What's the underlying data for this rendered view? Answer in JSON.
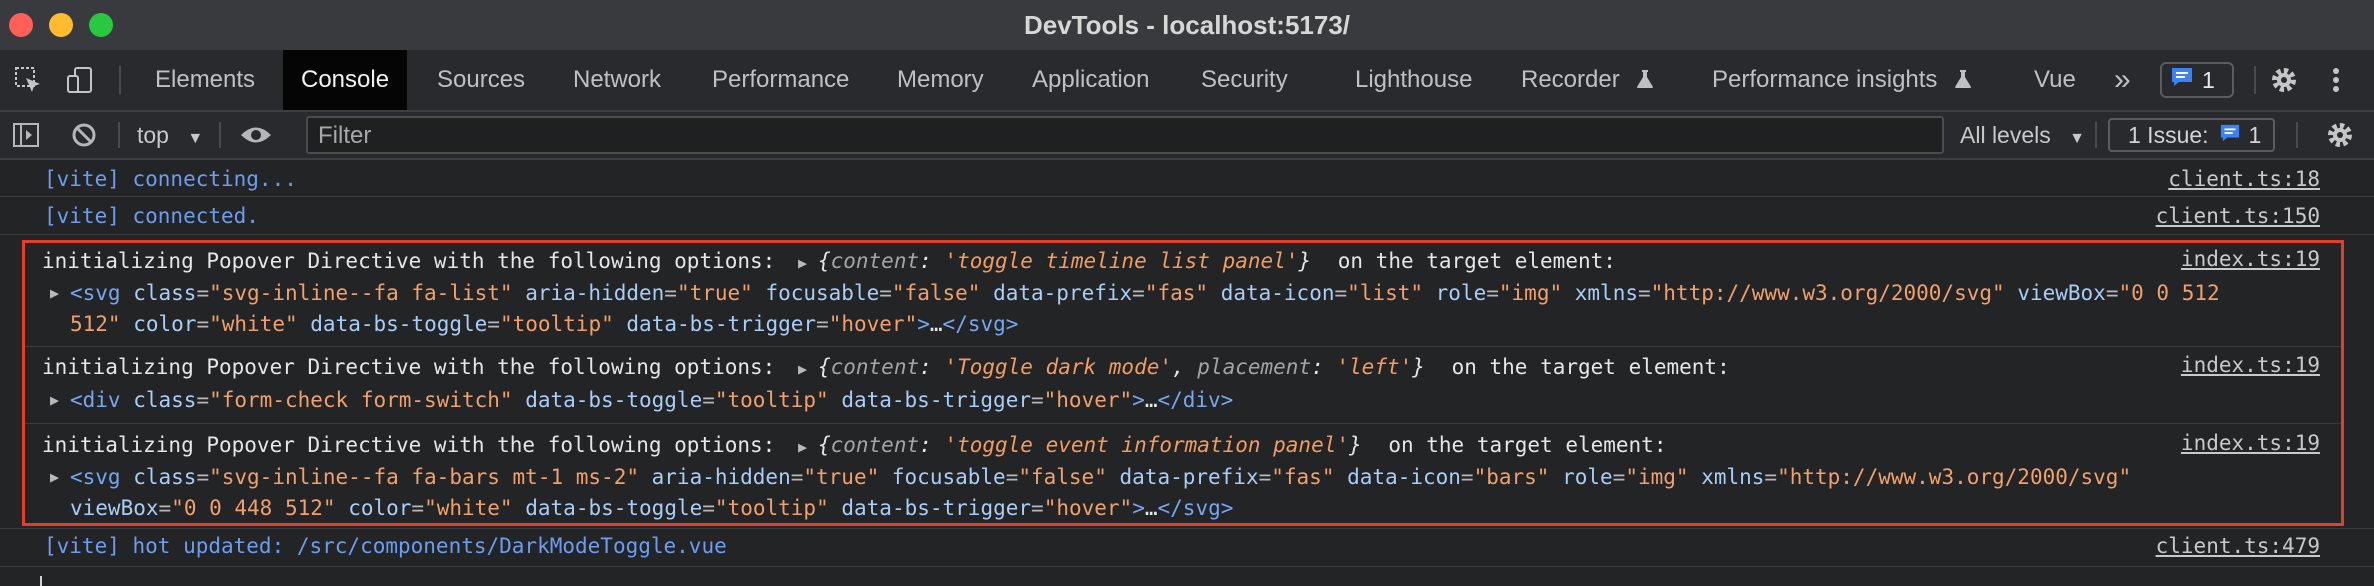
{
  "window": {
    "title": "DevTools - localhost:5173/"
  },
  "tabs": {
    "elements": "Elements",
    "console": "Console",
    "sources": "Sources",
    "network": "Network",
    "performance": "Performance",
    "memory": "Memory",
    "application": "Application",
    "security": "Security",
    "lighthouse": "Lighthouse",
    "recorder": "Recorder",
    "performance_insights": "Performance insights",
    "vue": "Vue",
    "more": "»",
    "message_count": "1"
  },
  "toolbar": {
    "context": "top",
    "filter_placeholder": "Filter",
    "levels": "All levels",
    "issues_label": "1 Issue:",
    "issues_count": "1"
  },
  "console": {
    "rows": [
      {
        "text": "[vite] connecting...",
        "source": "client.ts:18"
      },
      {
        "text": "[vite] connected.",
        "source": "client.ts:150"
      }
    ],
    "popover_logs": [
      {
        "prefix": "initializing Popover Directive with the following options: ",
        "options": [
          {
            "key": "content",
            "value": "'toggle timeline list panel'"
          }
        ],
        "suffix": "on the target element:",
        "source": "index.ts:19",
        "element_lines": [
          "<svg class=\"svg-inline--fa fa-list\" aria-hidden=\"true\" focusable=\"false\" data-prefix=\"fas\" data-icon=\"list\" role=\"img\" xmlns=\"http://www.w3.org/2000/svg\" viewBox=\"0 0 512",
          "512\" color=\"white\" data-bs-toggle=\"tooltip\" data-bs-trigger=\"hover\">…</svg>"
        ]
      },
      {
        "prefix": "initializing Popover Directive with the following options: ",
        "options": [
          {
            "key": "content",
            "value": "'Toggle dark mode'"
          },
          {
            "key": "placement",
            "value": "'left'"
          }
        ],
        "suffix": "on the target element:",
        "source": "index.ts:19",
        "element_lines": [
          "<div class=\"form-check form-switch\" data-bs-toggle=\"tooltip\" data-bs-trigger=\"hover\">…</div>"
        ]
      },
      {
        "prefix": "initializing Popover Directive with the following options: ",
        "options": [
          {
            "key": "content",
            "value": "'toggle event information panel'"
          }
        ],
        "suffix": "on the target element:",
        "source": "index.ts:19",
        "element_lines": [
          "<svg class=\"svg-inline--fa fa-bars mt-1 ms-2\" aria-hidden=\"true\" focusable=\"false\" data-prefix=\"fas\" data-icon=\"bars\" role=\"img\" xmlns=\"http://www.w3.org/2000/svg\"",
          "viewBox=\"0 0 448 512\" color=\"white\" data-bs-toggle=\"tooltip\" data-bs-trigger=\"hover\">…</svg>"
        ]
      }
    ],
    "last_row": {
      "text": "[vite] hot updated: /src/components/DarkModeToggle.vue",
      "source": "client.ts:479"
    }
  },
  "colors": {
    "background": "#232426",
    "highlight_border": "#e0402a",
    "vite_text": "#6d9df1",
    "badge_blue": "#3b82f6"
  }
}
